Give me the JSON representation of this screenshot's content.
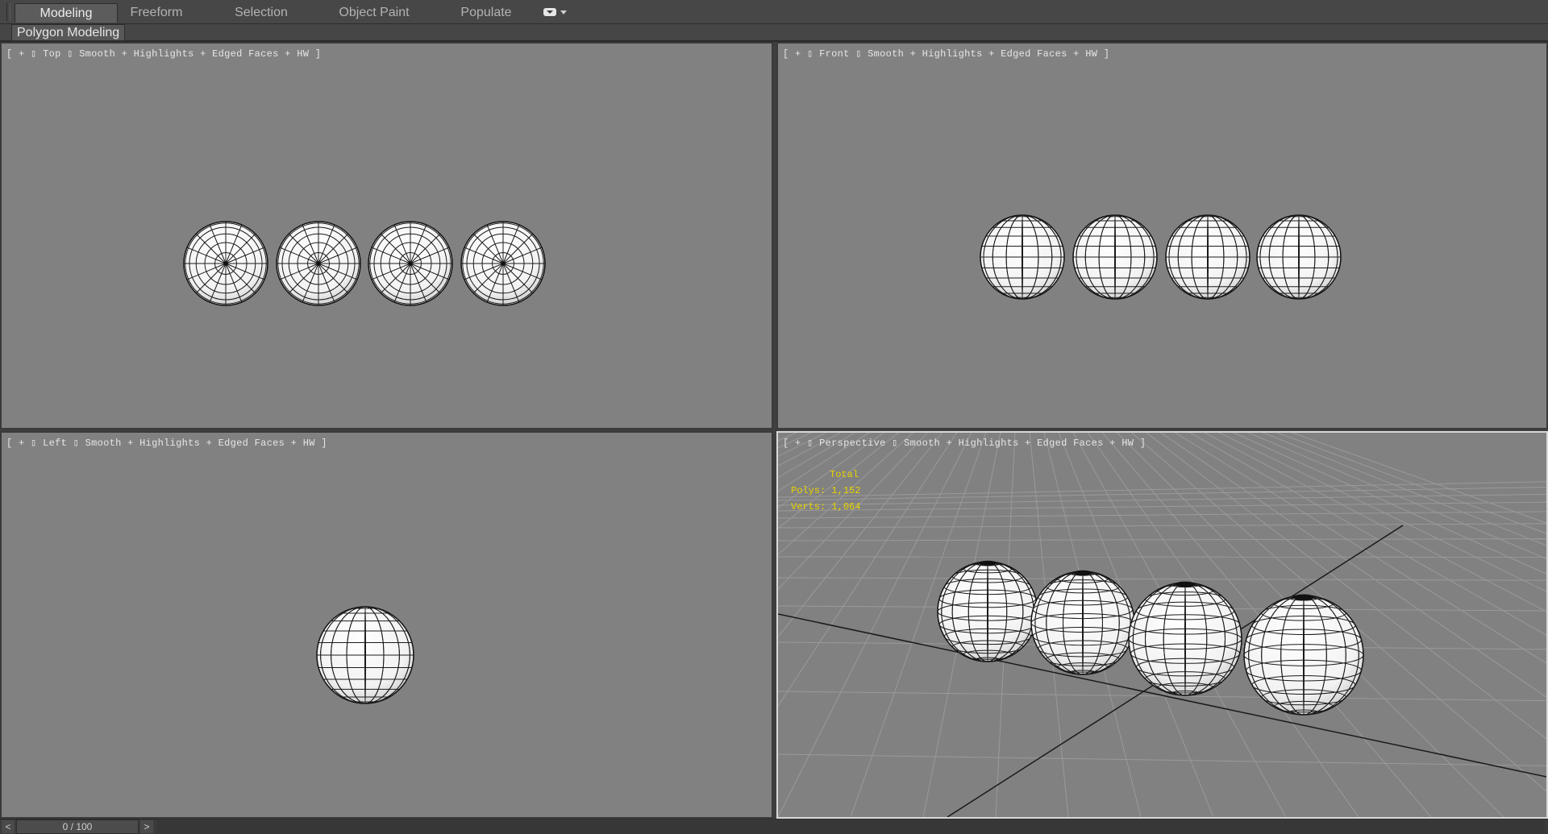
{
  "ribbon": {
    "tabs": [
      {
        "label": "Modeling",
        "active": true
      },
      {
        "label": "Freeform"
      },
      {
        "label": "Selection"
      },
      {
        "label": "Object Paint"
      },
      {
        "label": "Populate"
      }
    ],
    "panel_label": "Polygon Modeling"
  },
  "viewports": {
    "top": {
      "bracket_open": "[",
      "plus": "+",
      "view": "Top",
      "shading": "Smooth + Highlights + Edged Faces",
      "driver": "HW",
      "bracket_close": "]"
    },
    "front": {
      "bracket_open": "[",
      "plus": "+",
      "view": "Front",
      "shading": "Smooth + Highlights + Edged Faces",
      "driver": "HW",
      "bracket_close": "]"
    },
    "left": {
      "bracket_open": "[",
      "plus": "+",
      "view": "Left",
      "shading": "Smooth + Highlights + Edged Faces",
      "driver": "HW",
      "bracket_close": "]"
    },
    "perspective": {
      "bracket_open": "[",
      "plus": "+",
      "view": "Perspective",
      "shading": "Smooth + Highlights + Edged Faces",
      "driver": "HW",
      "bracket_close": "]"
    }
  },
  "stats": {
    "title": "Total",
    "polys_label": "Polys:",
    "polys_value": "1,152",
    "verts_label": "Verts:",
    "verts_value": "1,064"
  },
  "time_slider": {
    "prev": "<",
    "next": ">",
    "frame_display": "0 / 100"
  },
  "colors": {
    "viewport_bg": "#818181",
    "active_border": "#d9d9d9",
    "stats_text": "#e8d300",
    "ui_bg": "#474747"
  }
}
